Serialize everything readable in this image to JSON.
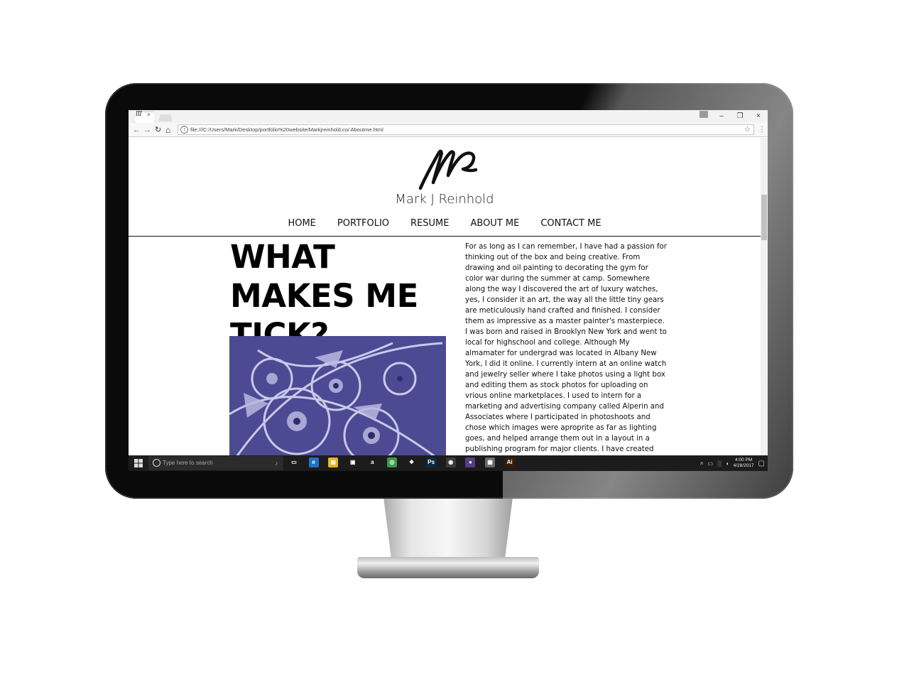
{
  "browser": {
    "tab_favicon": "Ɯ",
    "tab_close": "×",
    "url": "file:///C:/Users/Mark/Desktop/portfolio%20website/Markjreinhold.co/ Aboutme.html",
    "back": "←",
    "forward": "→",
    "reload": "↻",
    "home": "⌂",
    "star": "☆",
    "menu": "⋮",
    "win_min": "–",
    "win_max": "❐",
    "win_close": "×"
  },
  "site": {
    "name": "Mark J Reinhold",
    "nav": [
      "HOME",
      "PORTFOLIO",
      "RESUME",
      "ABOUT ME",
      "CONTACT ME"
    ]
  },
  "content": {
    "headline": "WHAT MAKES ME TICK?",
    "body": "For as long as I can remember, I have had a passion for thinking out of the box and being creative. From drawing and oil painting to decorating the gym for color war during the summer at camp. Somewhere along the way I discovered the art of luxury watches, yes, I consider it an art, the way all the little tiny gears are meticulously hand crafted and finished. I consider them as impressive as a master painter's masterpiece. I was born and raised in Brooklyn New York and went to local for highschool and college. Although My almamater for undergrad was located in Albany New York, I did it online. I currently intern at an online watch and jewelry seller where I take photos using a light box and editing them as stock photos for uploading on vrious online marketplaces. I used to intern for a marketing and advertising company called Alperin and Associates where I participated in photoshoots and chose which images were aproprite as far as lighting goes, and helped arrange them out in a layout in a publishing program for major clients. I have created many oil paintings some of which are of family members. I think"
  },
  "taskbar": {
    "search_placeholder": "Type here to search",
    "mic": "♪",
    "apps": [
      {
        "name": "task-view",
        "glyph": "▭",
        "color": "#1c1c1c"
      },
      {
        "name": "edge",
        "glyph": "e",
        "color": "#1e73c8"
      },
      {
        "name": "file-explorer",
        "glyph": "▤",
        "color": "#e6b422"
      },
      {
        "name": "store",
        "glyph": "▣",
        "color": "#1c1c1c"
      },
      {
        "name": "amazon",
        "glyph": "a",
        "color": "#1c1c1c"
      },
      {
        "name": "tripadvisor",
        "glyph": "◎",
        "color": "#3a9a4a"
      },
      {
        "name": "dropbox",
        "glyph": "❖",
        "color": "#1c1c1c"
      },
      {
        "name": "photoshop",
        "glyph": "Ps",
        "color": "#0b2a44"
      },
      {
        "name": "chrome",
        "glyph": "◉",
        "color": "#3a3a3a"
      },
      {
        "name": "tor",
        "glyph": "●",
        "color": "#5a3a8a"
      },
      {
        "name": "control-panel",
        "glyph": "▦",
        "color": "#6a6a6a"
      },
      {
        "name": "illustrator",
        "glyph": "Ai",
        "color": "#3a1a05"
      }
    ],
    "tray": [
      "˄",
      "▭",
      "░",
      "◖"
    ],
    "time": "4:00 PM",
    "date": "4/28/2017",
    "notification": "▢"
  }
}
